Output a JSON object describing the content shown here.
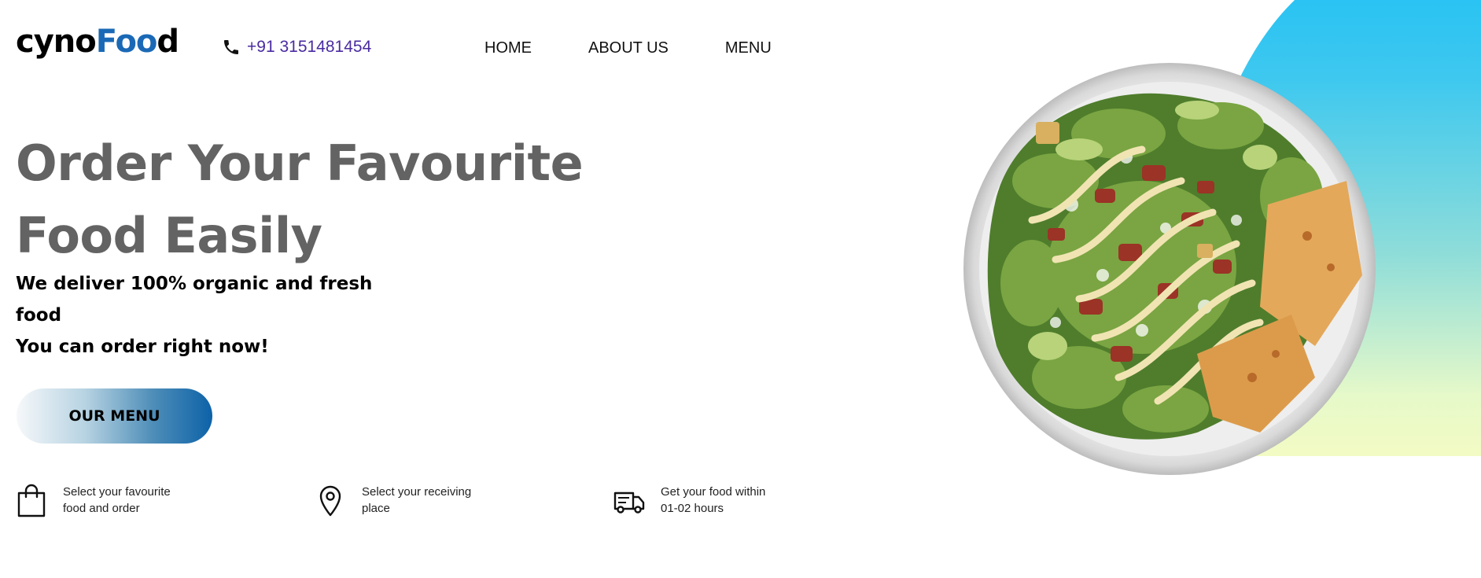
{
  "brand": {
    "logo_prefix": "cyno",
    "logo_accent": "Foo",
    "logo_suffix": "d"
  },
  "contact": {
    "phone": "+91 3151481454",
    "icon": "phone-icon"
  },
  "nav": {
    "home": "HOME",
    "about": "ABOUT US",
    "menu": "MENU"
  },
  "hero": {
    "headline_line1": "Order Your Favourite",
    "headline_line2": "Food Easily",
    "sub_line1": "We deliver 100% organic and fresh food",
    "sub_line2": "You can order right now!",
    "cta": "OUR MENU",
    "image": "salad-plate-image"
  },
  "steps": [
    {
      "icon": "shopping-bag-icon",
      "line1": "Select your favourite",
      "line2": "food and order"
    },
    {
      "icon": "location-pin-icon",
      "line1": "Select your receiving",
      "line2": "place"
    },
    {
      "icon": "delivery-truck-icon",
      "line1": "Get your food within",
      "line2": "01-02 hours"
    }
  ],
  "colors": {
    "accent": "#1a69b6",
    "phone": "#4a2ba0",
    "headline": "#636363",
    "blob_top": "#1ec0f5",
    "blob_bottom": "#f3fbc4"
  }
}
